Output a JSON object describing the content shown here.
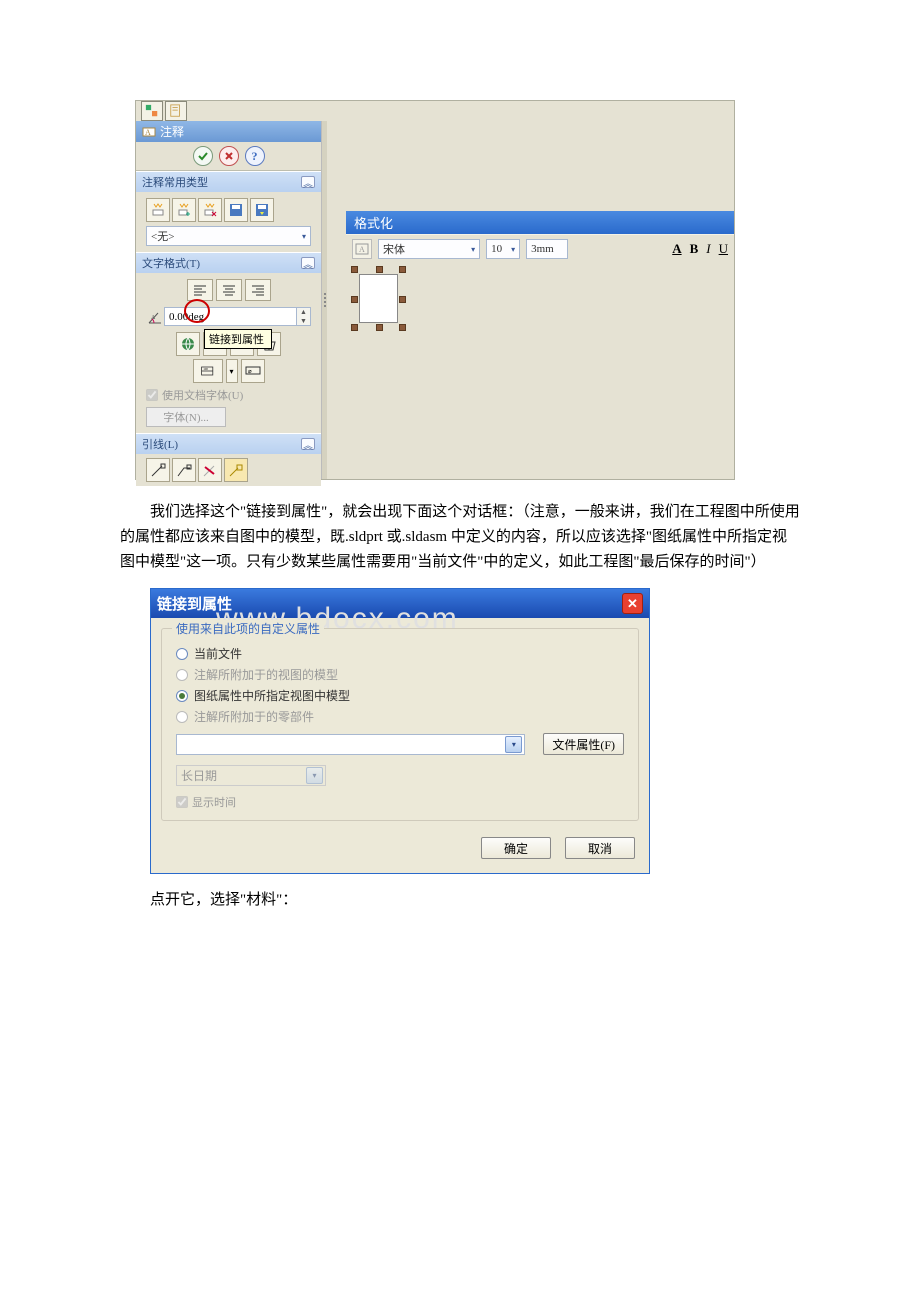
{
  "panel": {
    "title": "注释",
    "sections": {
      "common": {
        "title": "注释常用类型",
        "preset": "<无>"
      },
      "textfmt": {
        "title": "文字格式(T)",
        "angle": "0.00deg",
        "link_tooltip": "链接到属性",
        "use_doc_font": "使用文档字体(U)",
        "font_btn": "字体(N)..."
      },
      "leaders": {
        "title": "引线(L)"
      }
    }
  },
  "format_bar": {
    "title": "格式化",
    "font": "宋体",
    "size": "10",
    "unit": "3mm",
    "styleA": "A",
    "styleB": "B",
    "styleI": "I",
    "styleU": "U"
  },
  "para1": "我们选择这个\"链接到属性\"，就会出现下面这个对话框：（注意，一般来讲，我们在工程图中所使用的属性都应该来自图中的模型，既.sldprt 或.sldasm 中定义的内容，所以应该选择\"图纸属性中所指定视图中模型\"这一项。只有少数某些属性需要用\"当前文件\"中的定义，如此工程图\"最后保存的时间\"）",
  "dialog": {
    "title": "链接到属性",
    "group_legend": "使用来自此项的自定义属性",
    "opt_current": "当前文件",
    "opt_view_model": "注解所附加于的视图的模型",
    "opt_sheet_model": "图纸属性中所指定视图中模型",
    "opt_component": "注解所附加于的零部件",
    "btn_file_prop": "文件属性(F)",
    "date_fmt": "长日期",
    "show_time": "显示时间",
    "ok": "确定",
    "cancel": "取消"
  },
  "para2": "点开它，选择\"材料\"："
}
